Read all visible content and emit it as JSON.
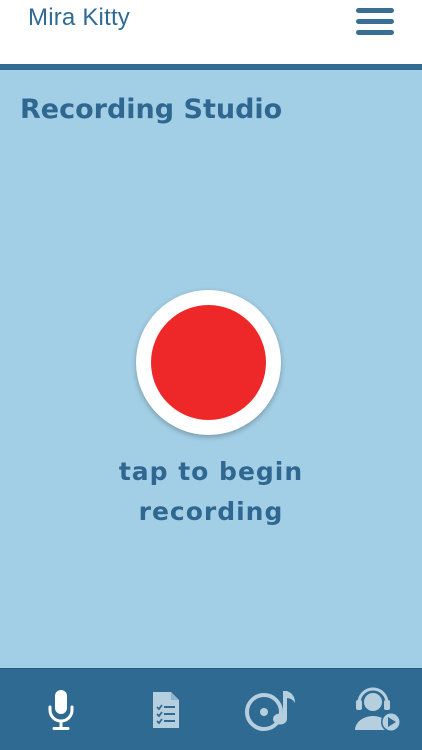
{
  "header": {
    "title": "Mira Kitty",
    "menu_icon": "hamburger-menu-icon"
  },
  "main": {
    "page_title": "Recording Studio",
    "record_button_icon": "record-dot-icon",
    "hint_line1": "tap to begin",
    "hint_line2": "recording"
  },
  "tabbar": {
    "tabs": [
      {
        "icon": "microphone-icon",
        "active": true
      },
      {
        "icon": "checklist-document-icon",
        "active": false
      },
      {
        "icon": "disc-music-note-icon",
        "active": false
      },
      {
        "icon": "headset-support-play-icon",
        "active": false
      }
    ]
  },
  "colors": {
    "header_bg": "#ffffff",
    "accent_blue": "#2f6a92",
    "background_blue": "#a3cfe6",
    "record_red": "#ee2829",
    "icon_active": "#ffffff",
    "icon_inactive": "#b6cfdf"
  }
}
